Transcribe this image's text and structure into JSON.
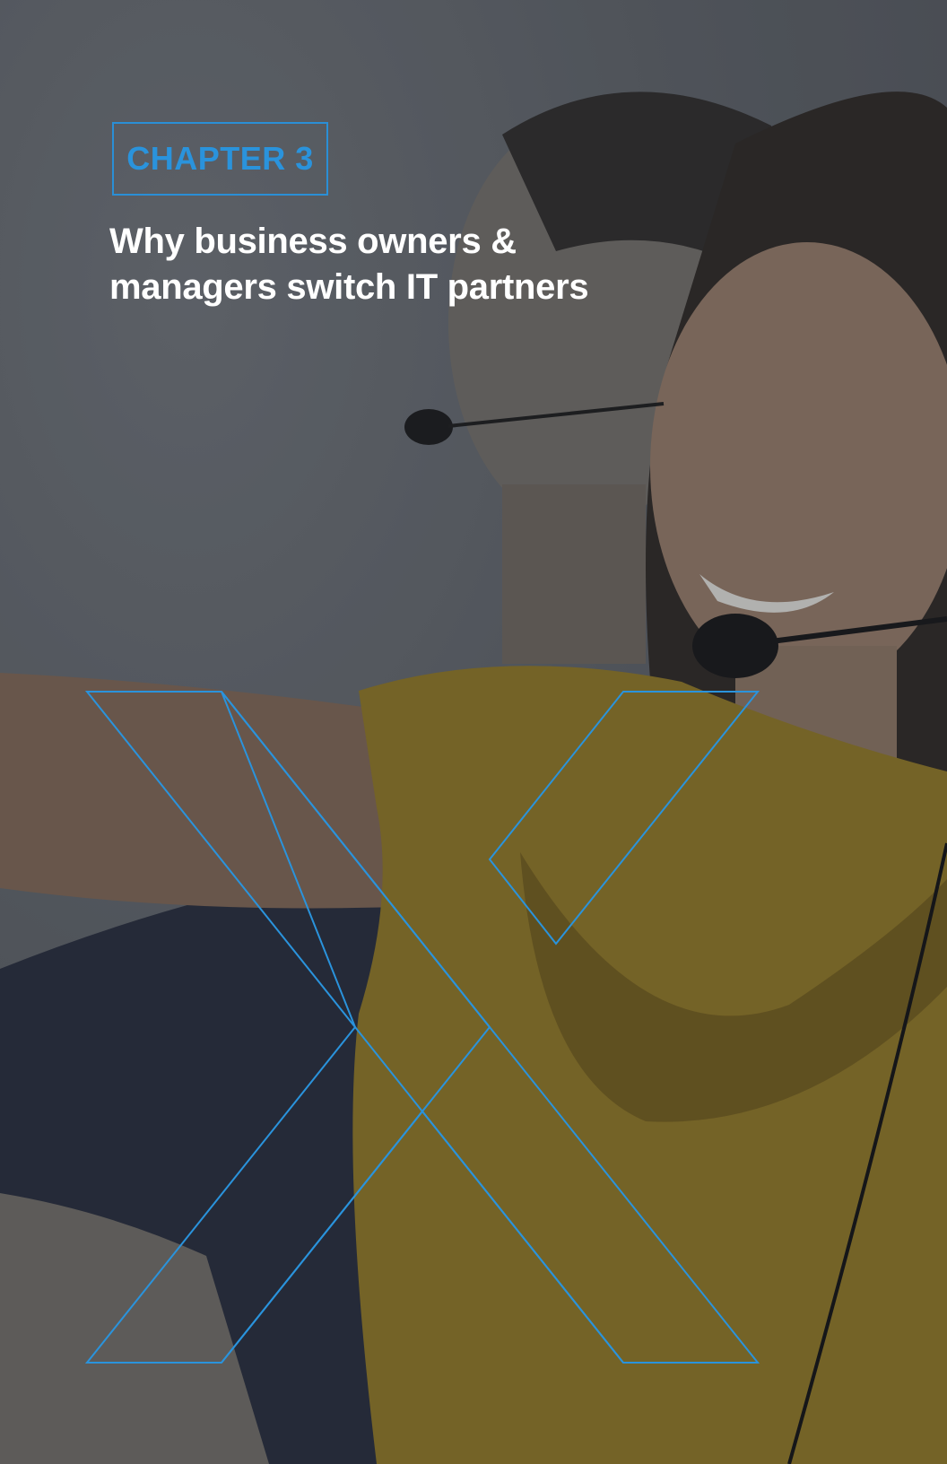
{
  "chapter": {
    "label": "CHAPTER 3"
  },
  "headline": {
    "line1": "Why business owners &",
    "line2": "managers switch IT partners"
  },
  "colors": {
    "accent_blue": "#2a93dc",
    "headline_white": "#ffffff",
    "overlay": "#5b5f66",
    "shirt_yellow": "#b8951c"
  },
  "icons": {
    "decorative_mark": "x-logo-outline-icon"
  }
}
